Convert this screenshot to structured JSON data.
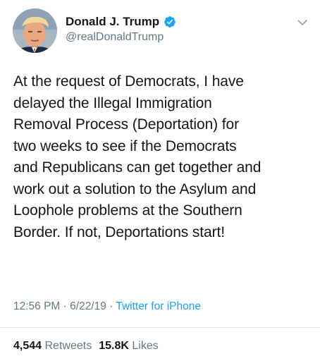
{
  "author": {
    "display_name": "Donald J. Trump",
    "handle": "@realDonaldTrump",
    "verified": true,
    "avatar_icon": "profile-photo"
  },
  "tweet": {
    "lines": [
      "At the request of Democrats, I have",
      "delayed the Illegal Immigration",
      "Removal Process (Deportation) for",
      "two weeks to see if the Democrats",
      "and Republicans can get together and",
      "work out a solution to the Asylum and",
      "Loophole problems at the Southern",
      "Border. If not, Deportations start!"
    ]
  },
  "meta": {
    "time": "12:56 PM",
    "separator": " · ",
    "date": "6/22/19",
    "source": "Twitter for iPhone"
  },
  "stats": {
    "retweets_count": "4,544",
    "retweets_label": "Retweets",
    "likes_count": "15.8K",
    "likes_label": "Likes"
  },
  "colors": {
    "text": "#14171a",
    "secondary": "#657786",
    "link": "#1da1f2",
    "verified": "#1da1f2"
  }
}
